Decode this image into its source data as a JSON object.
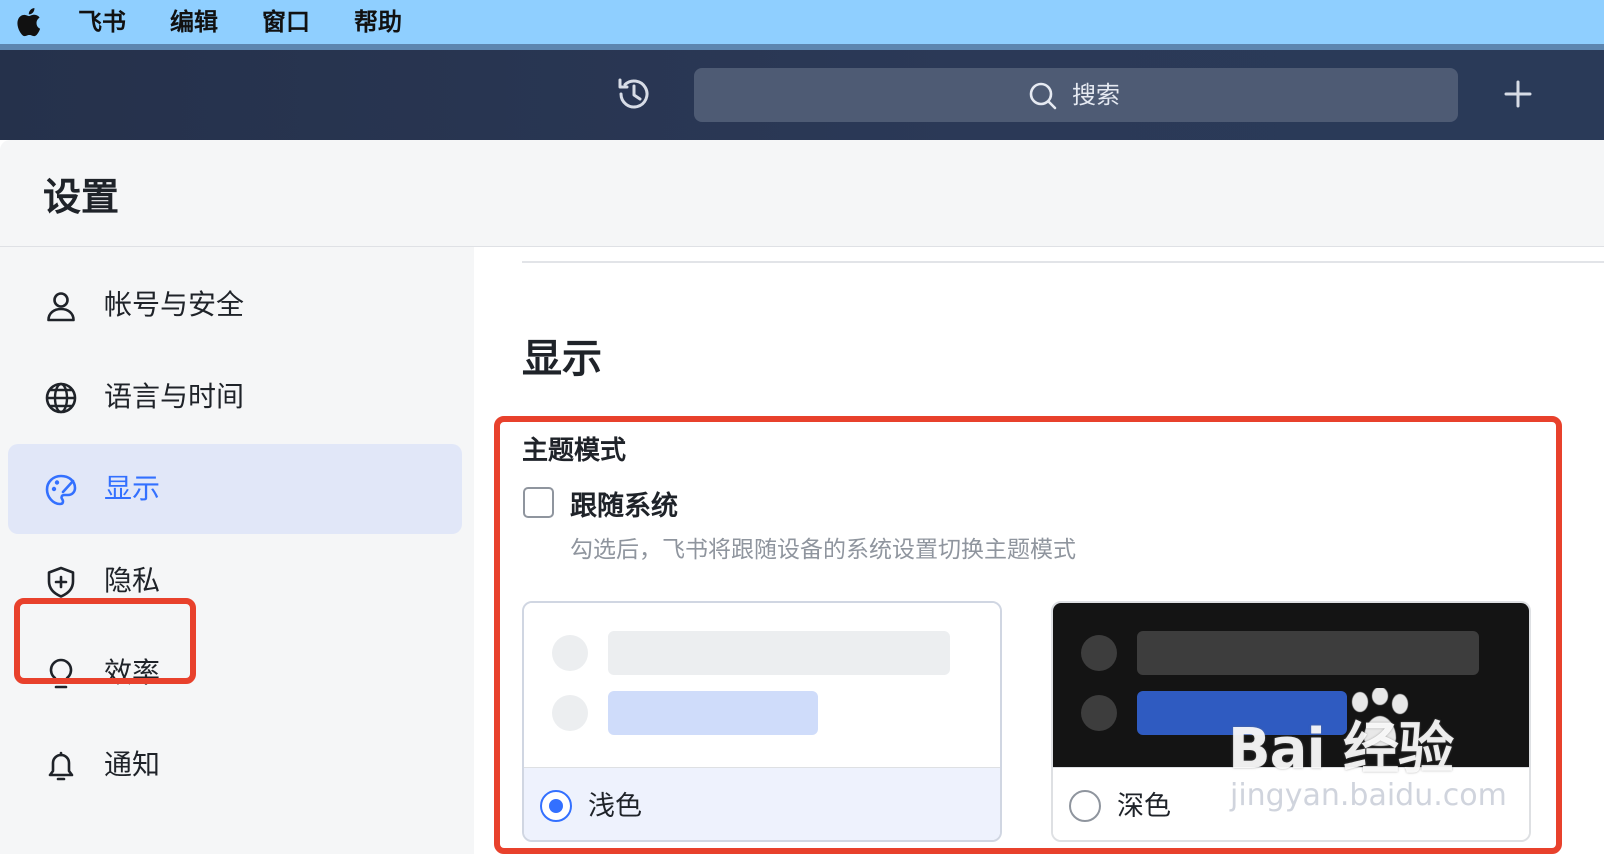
{
  "menubar": {
    "items": [
      "飞书",
      "编辑",
      "窗口",
      "帮助"
    ]
  },
  "toolbar": {
    "search_placeholder": "搜索"
  },
  "settings": {
    "title": "设置",
    "nav": [
      {
        "label": "帐号与安全",
        "icon": "user-icon"
      },
      {
        "label": "语言与时间",
        "icon": "globe-icon"
      },
      {
        "label": "显示",
        "icon": "palette-icon",
        "active": true
      },
      {
        "label": "隐私",
        "icon": "shield-icon"
      },
      {
        "label": "效率",
        "icon": "lightbulb-icon"
      },
      {
        "label": "通知",
        "icon": "bell-icon"
      }
    ]
  },
  "main": {
    "section_title": "显示",
    "theme": {
      "label": "主题模式",
      "follow_system": {
        "label": "跟随系统",
        "checked": false,
        "description": "勾选后，飞书将跟随设备的系统设置切换主题模式"
      },
      "options": [
        {
          "label": "浅色",
          "selected": true
        },
        {
          "label": "深色",
          "selected": false
        }
      ]
    }
  },
  "watermark": {
    "brand": "Bai 经验",
    "url": "jingyan.baidu.com"
  },
  "colors": {
    "accent": "#3370ff",
    "highlight_box": "#e8412c",
    "toolbar_bg": "#2b3957",
    "menubar_bg": "#8fcfff"
  }
}
